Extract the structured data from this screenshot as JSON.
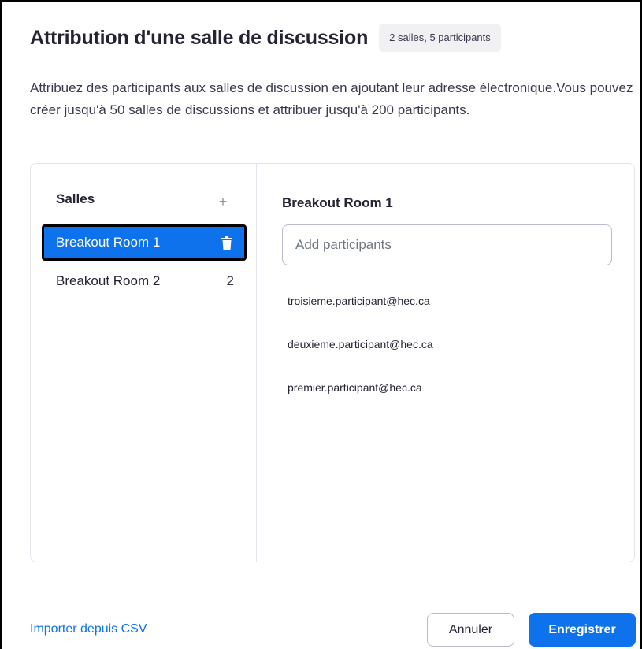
{
  "dialog": {
    "title": "Attribution d'une salle de discussion",
    "badge": "2 salles, 5 participants",
    "description": "Attribuez des participants aux salles de discussion en ajoutant leur adresse électronique.Vous pouvez créer jusqu'à 50 salles de discussions et attribuer jusqu'à 200 participants."
  },
  "rooms": {
    "header": "Salles",
    "add_symbol": "+",
    "items": [
      {
        "label": "Breakout Room 1",
        "selected": true,
        "action_icon": "trash-icon"
      },
      {
        "label": "Breakout Room 2",
        "selected": false,
        "count": "2"
      }
    ]
  },
  "detail": {
    "room_title": "Breakout Room 1",
    "add_placeholder": "Add participants",
    "participants": [
      "troisieme.participant@hec.ca",
      "deuxieme.participant@hec.ca",
      "premier.participant@hec.ca"
    ]
  },
  "footer": {
    "import_label": "Importer depuis CSV",
    "cancel_label": "Annuler",
    "save_label": "Enregistrer"
  },
  "colors": {
    "accent": "#0e72ed",
    "text": "#232333",
    "border": "#e4e4ed"
  }
}
